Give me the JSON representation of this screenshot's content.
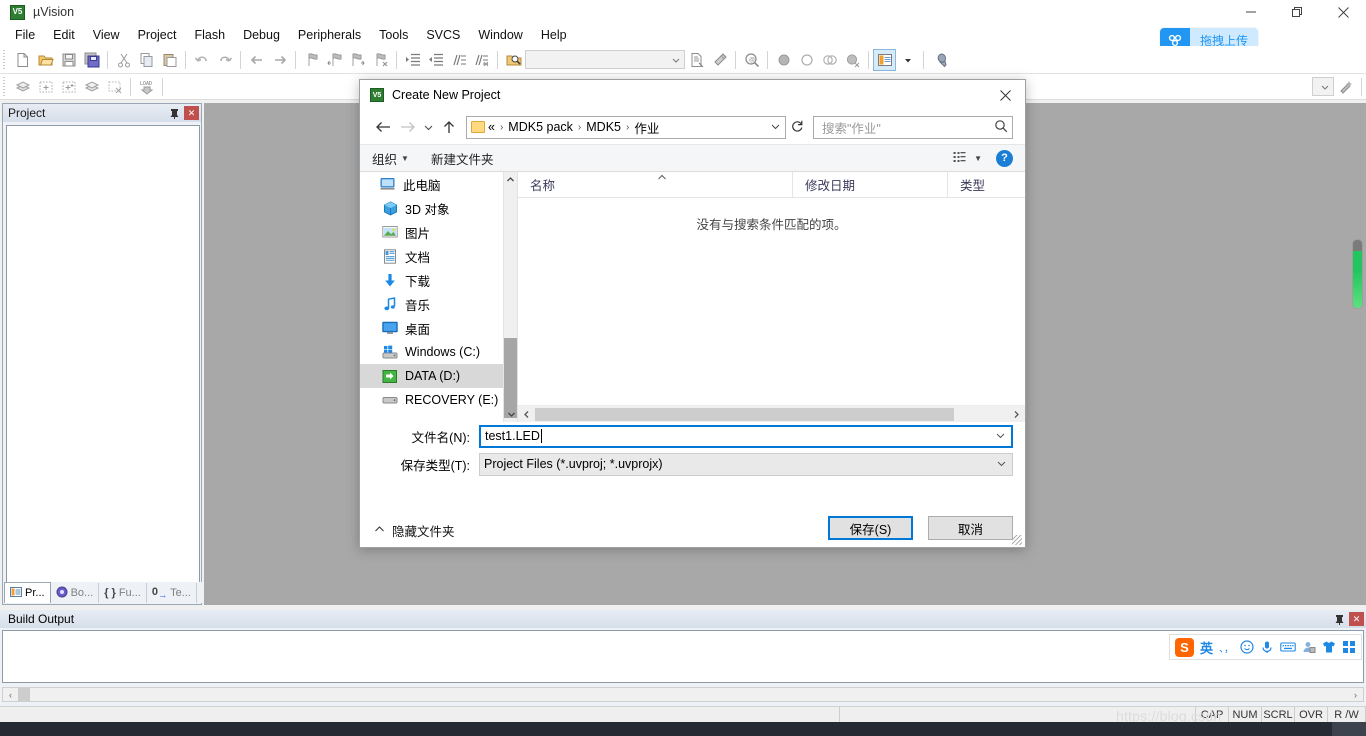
{
  "app": {
    "title": "µVision",
    "icon": "uvision-icon",
    "menu": [
      "File",
      "Edit",
      "View",
      "Project",
      "Flash",
      "Debug",
      "Peripherals",
      "Tools",
      "SVCS",
      "Window",
      "Help"
    ],
    "window_controls": [
      "minimize",
      "restore",
      "close"
    ]
  },
  "baidu": {
    "label": "拖拽上传",
    "icon": "baidu-netdisk-icon",
    "accent": "#2196f3",
    "bg": "#cfeaff"
  },
  "toolbar1": {
    "icons": [
      "new-file-icon",
      "open-file-icon",
      "save-icon",
      "save-all-icon",
      "cut-icon",
      "copy-icon",
      "paste-icon",
      "undo-icon",
      "redo-icon",
      "navigate-back-icon",
      "navigate-forward-icon",
      "bookmark-toggle-icon",
      "bookmark-prev-icon",
      "bookmark-next-icon",
      "bookmark-clear-icon",
      "indent-icon",
      "outdent-icon",
      "comment-icon",
      "uncomment-icon"
    ],
    "icons2": [
      "find-in-files-icon",
      "build-output-icon",
      "configure-icon",
      "magnifier-icon",
      "breakpoint-icon",
      "breakpoint-disable-icon",
      "breakpoint-kill-all-icon",
      "breakpoint-disable-all-icon",
      "project-window-icon",
      "configure-target-icon"
    ],
    "combo_value": ""
  },
  "toolbar2": {
    "icons": [
      "build-icon",
      "rebuild-icon",
      "batch-build-icon",
      "translate-icon",
      "stop-build-icon",
      "download-icon"
    ],
    "target_combo": "",
    "target_options_icon": "target-options-icon"
  },
  "project_panel": {
    "title": "Project",
    "pin_icon": "pin-icon",
    "close_icon": "close-icon",
    "tabs": [
      {
        "label": "Pr...",
        "icon": "project-icon",
        "selected": true
      },
      {
        "label": "Bo...",
        "icon": "books-icon",
        "selected": false
      },
      {
        "label": "Fu...",
        "icon": "functions-icon",
        "selected": false
      },
      {
        "label": "Te...",
        "icon": "templates-icon",
        "selected": false
      }
    ]
  },
  "build_output": {
    "title": "Build Output",
    "pin_icon": "pin-icon",
    "close_icon": "close-icon",
    "content": ""
  },
  "sogou": {
    "logo": "S",
    "items": [
      "英",
      "、，",
      "☺",
      "🎤",
      "⌨",
      "👤",
      "👕",
      "▦"
    ]
  },
  "status_bar": {
    "left": "",
    "keys": [
      "CAP",
      "NUM",
      "SCRL",
      "OVR",
      "R /W"
    ],
    "watermark": "https://blog.csdn"
  },
  "dialog": {
    "title": "Create New Project",
    "icon": "uvision-icon",
    "close_icon": "close-icon",
    "nav": {
      "back_icon": "arrow-left-icon",
      "forward_icon": "arrow-right-icon",
      "recent_icon": "chevron-down-icon",
      "up_icon": "arrow-up-icon",
      "folder_icon": "folder-icon",
      "breadcrumb_prefix": "«",
      "breadcrumbs": [
        "MDK5 pack",
        "MDK5",
        "作业"
      ],
      "dropdown_icon": "chevron-down-icon",
      "refresh_icon": "refresh-icon"
    },
    "search": {
      "placeholder": "搜索\"作业\"",
      "icon": "search-icon"
    },
    "command_bar": {
      "organize": "组织",
      "new_folder": "新建文件夹",
      "view_icon": "view-list-icon",
      "view_caret_icon": "chevron-down-icon",
      "help_icon": "help-icon"
    },
    "nav_pane": {
      "items": [
        {
          "label": "此电脑",
          "icon": "this-pc-icon",
          "selected": false
        },
        {
          "label": "3D 对象",
          "icon": "3d-objects-icon",
          "selected": false
        },
        {
          "label": "图片",
          "icon": "pictures-icon",
          "selected": false
        },
        {
          "label": "文档",
          "icon": "documents-icon",
          "selected": false
        },
        {
          "label": "下载",
          "icon": "downloads-icon",
          "selected": false
        },
        {
          "label": "音乐",
          "icon": "music-icon",
          "selected": false
        },
        {
          "label": "桌面",
          "icon": "desktop-icon",
          "selected": false
        },
        {
          "label": "Windows (C:)",
          "icon": "windows-drive-icon",
          "selected": false
        },
        {
          "label": "DATA (D:)",
          "icon": "data-drive-icon",
          "selected": true
        },
        {
          "label": "RECOVERY (E:)",
          "icon": "recovery-drive-icon",
          "selected": false
        }
      ]
    },
    "file_list": {
      "columns": [
        "名称",
        "修改日期",
        "类型"
      ],
      "sort_icon": "sort-ascending-icon",
      "empty_message": "没有与搜索条件匹配的项。",
      "rows": []
    },
    "fields": {
      "filename_label": "文件名(N):",
      "filename_value": "test1.LED",
      "savetype_label": "保存类型(T):",
      "savetype_value": "Project Files (*.uvproj; *.uvprojx)",
      "dropdown_icon": "chevron-down-icon"
    },
    "footer": {
      "hide_folders_label": "隐藏文件夹",
      "hide_folders_icon": "chevron-up-icon",
      "save_label": "保存(S)",
      "cancel_label": "取消",
      "accent": "#0078d7"
    }
  }
}
